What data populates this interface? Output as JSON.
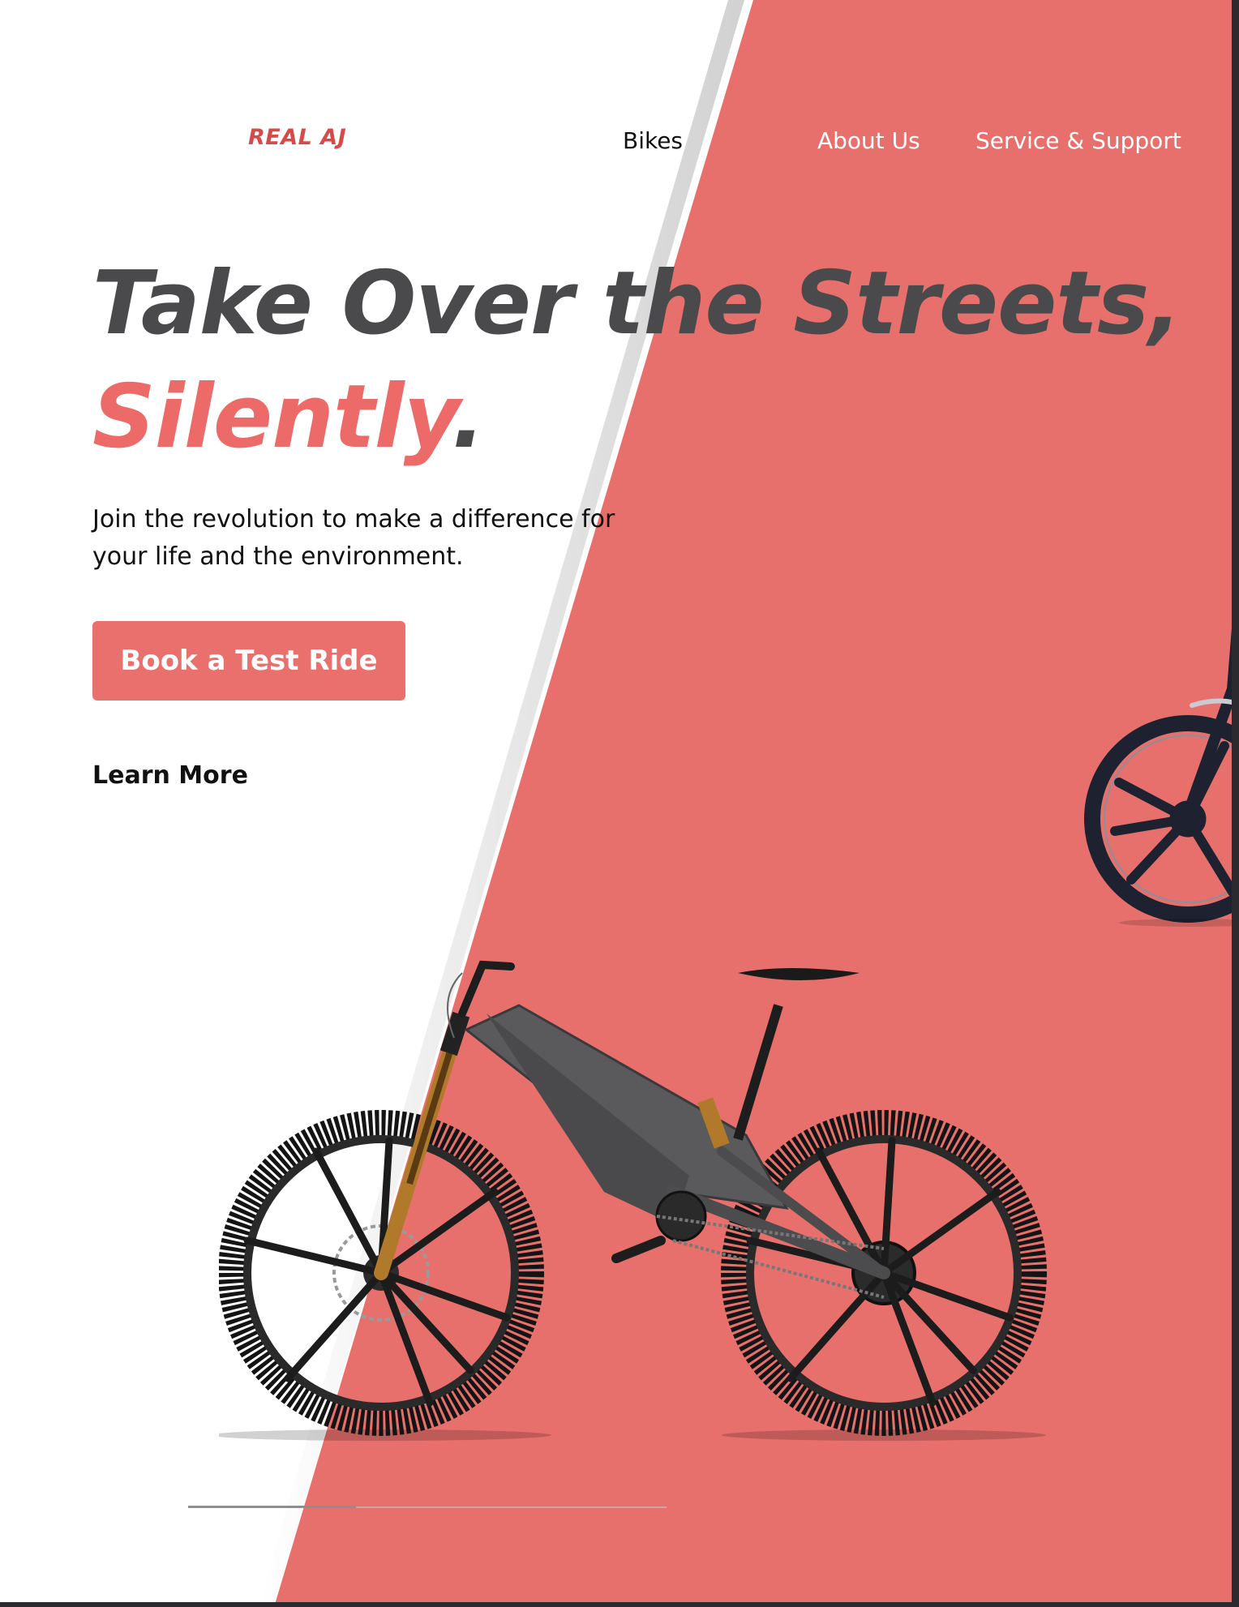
{
  "nav": {
    "logo": "REAL AJ",
    "links": [
      "Bikes",
      "About Us",
      "Service & Support"
    ]
  },
  "hero": {
    "headline_line1": "Take Over the Streets,",
    "headline_accent": "Silently",
    "headline_period": ".",
    "subtext": "Join the revolution to make a difference for your life and the environment.",
    "cta_label": "Book a Test Ride",
    "secondary_link": "Learn More"
  },
  "carousel": {
    "progress": 0.35
  },
  "colors": {
    "accent": "#ec6b68",
    "background": "#e8706c",
    "headline": "#4a4a4c",
    "logo": "#d84a47"
  },
  "icons": [
    "electric-mountain-bike-image",
    "partial-bike-image"
  ]
}
